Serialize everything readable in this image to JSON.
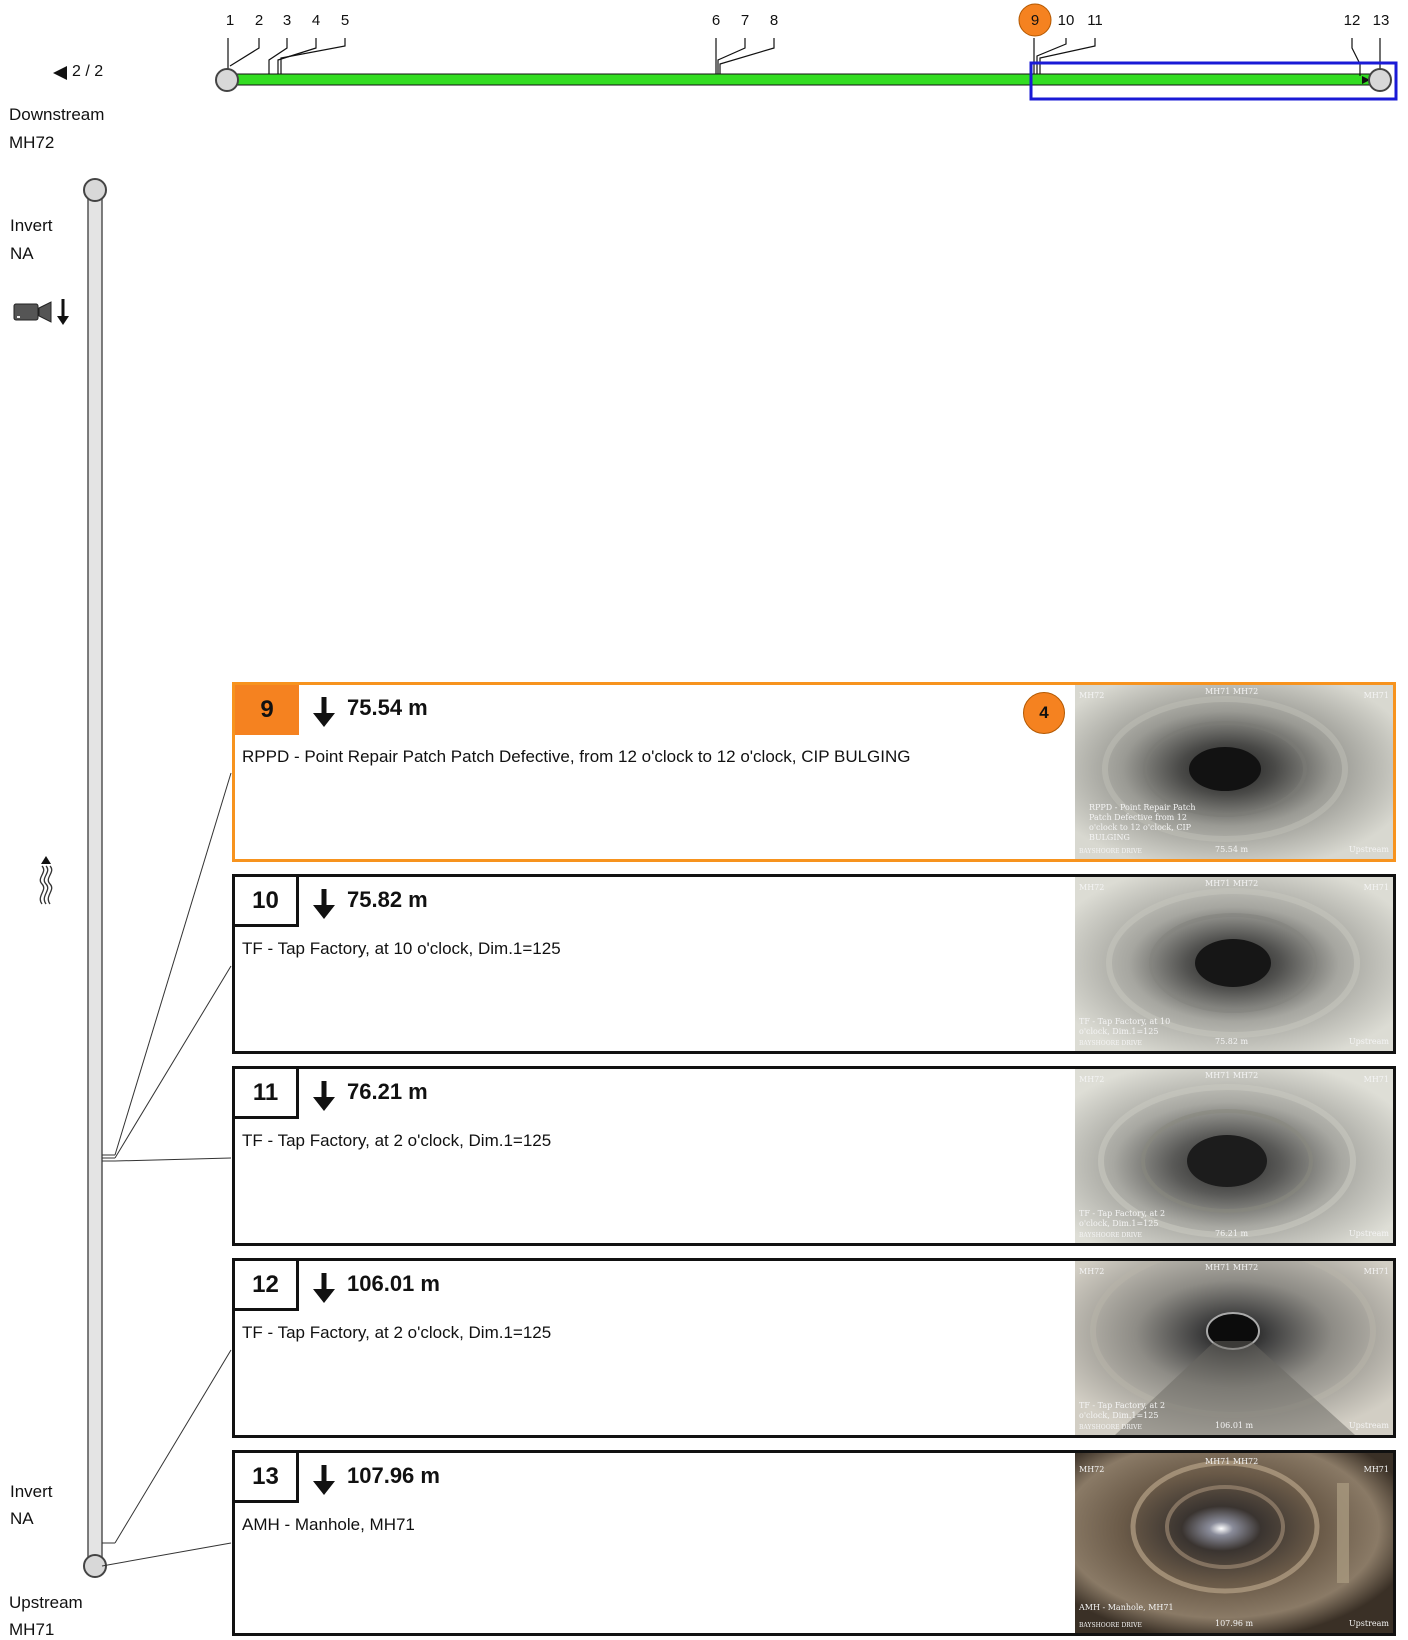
{
  "nav": {
    "page_indicator": "2 / 2"
  },
  "downstream": {
    "label": "Downstream",
    "node": "MH72"
  },
  "upstream": {
    "label": "Upstream",
    "node": "MH71"
  },
  "invert_top": {
    "label": "Invert",
    "value": "NA"
  },
  "invert_bottom": {
    "label": "Invert",
    "value": "NA"
  },
  "icons": {
    "camera": "camera-icon",
    "direction": "down-arrow-icon",
    "flow": "flow-icon",
    "nav_back": "triangle-left-icon"
  },
  "colors": {
    "pipe_fill": "#33dd22",
    "selection_box": "#1a1ad6",
    "highlight": "#f58220"
  },
  "timeline": {
    "tick_labels": [
      "1",
      "2",
      "3",
      "4",
      "5",
      "6",
      "7",
      "8",
      "9",
      "10",
      "11",
      "12",
      "13"
    ],
    "highlighted": "9"
  },
  "observations": [
    {
      "number": "9",
      "distance": "75.54 m",
      "description": "RPPD - Point Repair Patch Patch Defective, from 12 o'clock to 12 o'clock, CIP BULGING",
      "grade": "4",
      "selected": true,
      "thumb": {
        "top_left": "MH72",
        "top_center": "MH71 MH72",
        "top_right": "MH71",
        "caption": "RPPD - Point Repair Patch Patch Defective from 12 o'clock to 12 o'clock, CIP BULGING",
        "street": "BAYSHOORE DRIVE",
        "dist": "75.54 m",
        "dir": "Upstream"
      }
    },
    {
      "number": "10",
      "distance": "75.82 m",
      "description": "TF - Tap Factory, at 10 o'clock, Dim.1=125",
      "grade": "",
      "selected": false,
      "thumb": {
        "top_left": "MH72",
        "top_center": "MH71 MH72",
        "top_right": "MH71",
        "caption": "TF - Tap Factory, at 10 o'clock, Dim.1=125",
        "street": "BAYSHOORE DRIVE",
        "dist": "75.82 m",
        "dir": "Upstream"
      }
    },
    {
      "number": "11",
      "distance": "76.21 m",
      "description": "TF - Tap Factory, at 2 o'clock, Dim.1=125",
      "grade": "",
      "selected": false,
      "thumb": {
        "top_left": "MH72",
        "top_center": "MH71 MH72",
        "top_right": "MH71",
        "caption": "TF - Tap Factory, at 2 o'clock, Dim.1=125",
        "street": "BAYSHOORE DRIVE",
        "dist": "76.21 m",
        "dir": "Upstream"
      }
    },
    {
      "number": "12",
      "distance": "106.01 m",
      "description": "TF - Tap Factory, at 2 o'clock, Dim.1=125",
      "grade": "",
      "selected": false,
      "thumb": {
        "top_left": "MH72",
        "top_center": "MH71 MH72",
        "top_right": "MH71",
        "caption": "TF - Tap Factory, at 2 o'clock, Dim.1=125",
        "street": "BAYSHOORE DRIVE",
        "dist": "106.01 m",
        "dir": "Upstream"
      }
    },
    {
      "number": "13",
      "distance": "107.96 m",
      "description": "AMH - Manhole, MH71",
      "grade": "",
      "selected": false,
      "thumb": {
        "top_left": "MH72",
        "top_center": "MH71 MH72",
        "top_right": "MH71",
        "caption": "AMH - Manhole, MH71",
        "street": "BAYSHOORE DRIVE",
        "dist": "107.96 m",
        "dir": "Upstream"
      }
    }
  ]
}
